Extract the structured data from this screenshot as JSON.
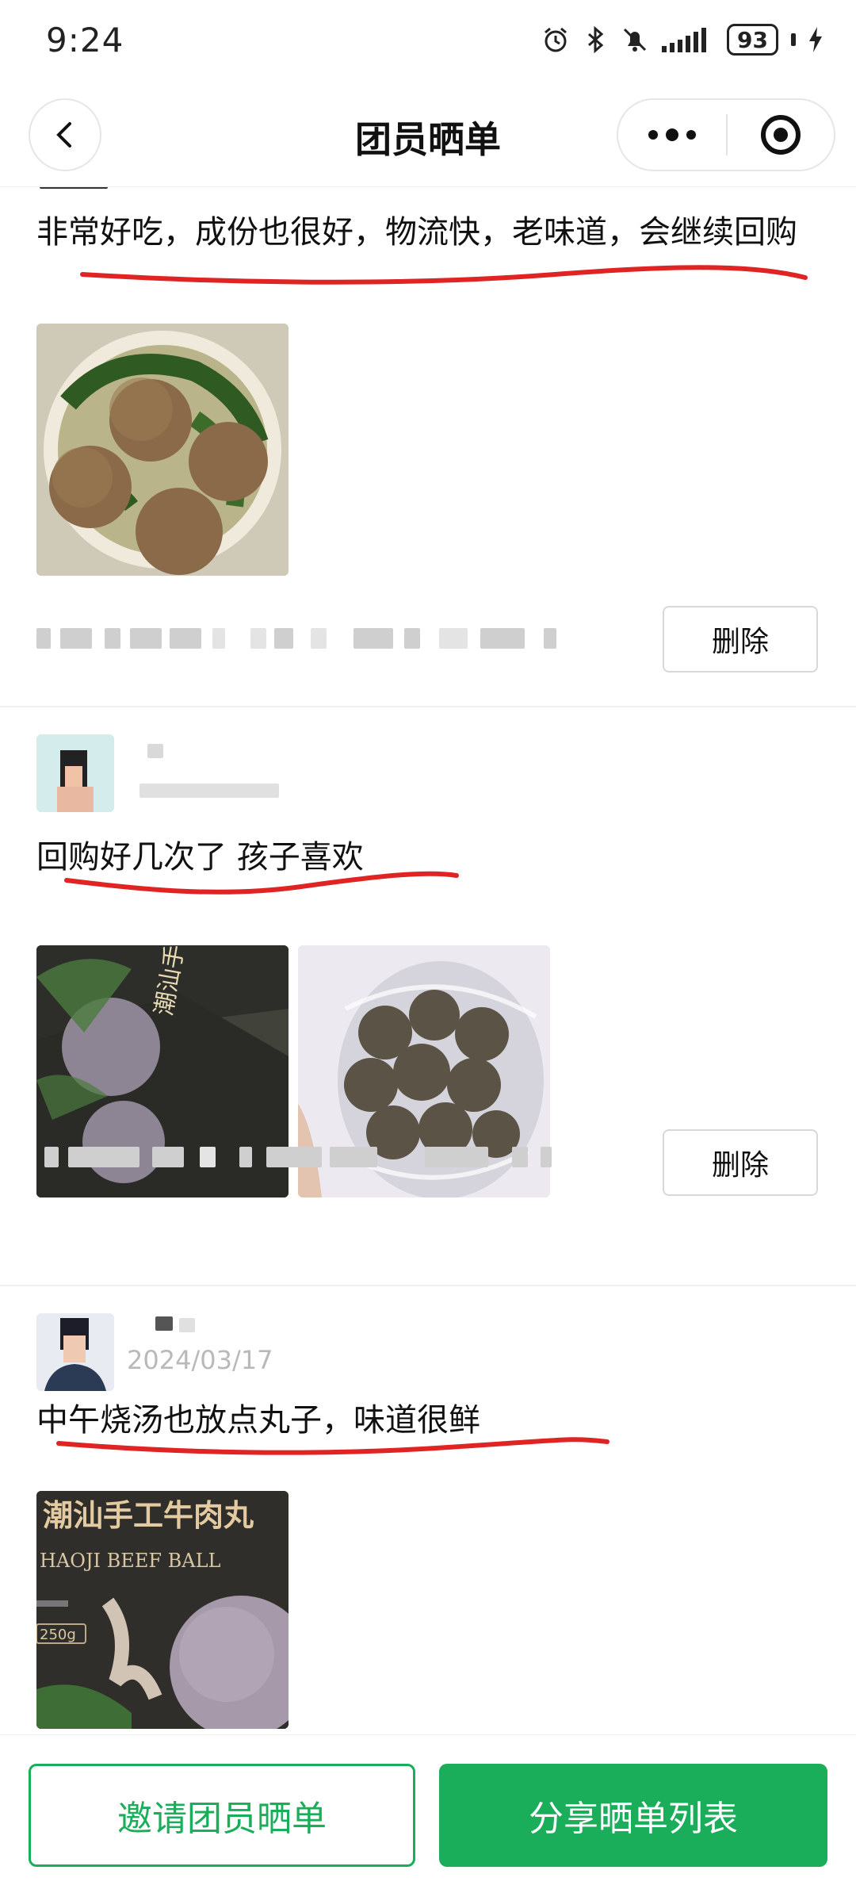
{
  "status_bar": {
    "time": "9:24",
    "battery": "93"
  },
  "nav": {
    "title": "团员晒单"
  },
  "posts": [
    {
      "text": "非常好吃，成份也很好，物流快，老味道，会继续回购",
      "delete_label": "删除"
    },
    {
      "text": "回购好几次了 孩子喜欢",
      "delete_label": "删除"
    },
    {
      "date": "2024/03/17",
      "text": "中午烧汤也放点丸子，味道很鲜"
    }
  ],
  "product": {
    "package_title": "潮汕手工牛肉丸",
    "package_subtitle": "HAOJI BEEF BALL",
    "net_weight": "250g"
  },
  "bottom": {
    "invite_label": "邀请团员晒单",
    "share_label": "分享晒单列表"
  },
  "colors": {
    "brand_green": "#1aad5a",
    "underline_red": "#e02424"
  }
}
